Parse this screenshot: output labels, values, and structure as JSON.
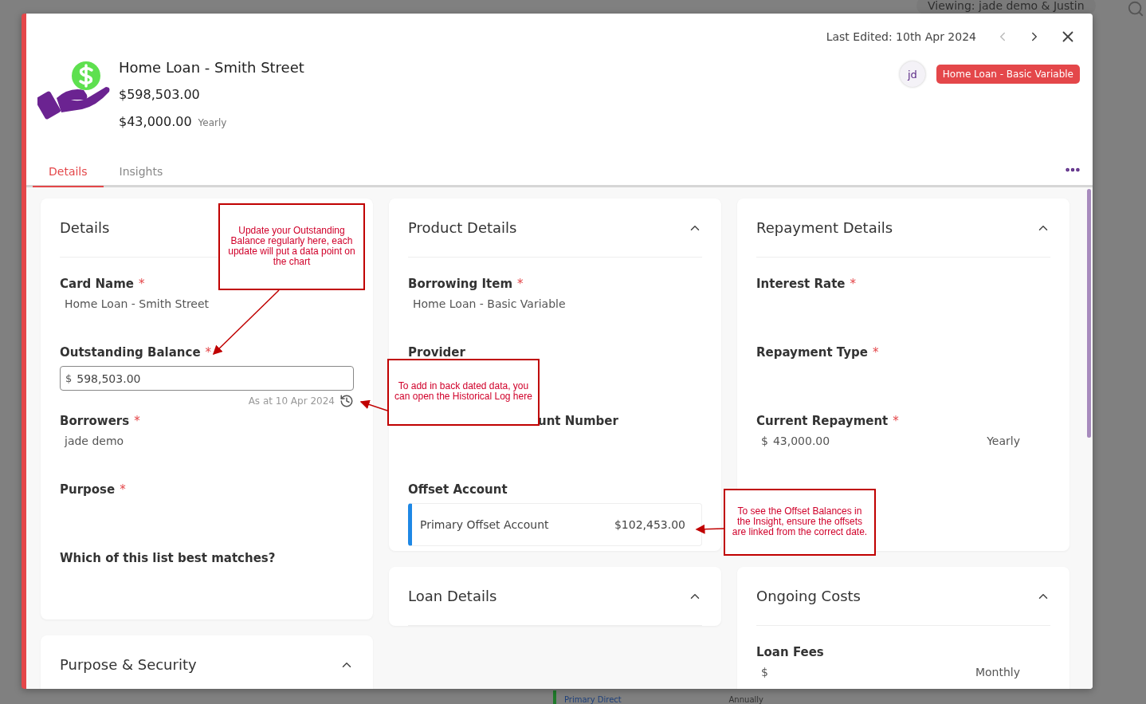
{
  "background": {
    "viewing": "Viewing: jade demo & Justin",
    "bottom_texts": [
      {
        "text": "Primary Direct",
        "kind": "link"
      },
      {
        "text": "Annually",
        "kind": "plain"
      }
    ]
  },
  "modal": {
    "last_edited": "Last Edited: 10th Apr 2024",
    "title": "Home Loan - Smith Street",
    "balance": "$598,503.00",
    "repayment": "$43,000.00",
    "repayment_frequency": "Yearly",
    "avatar": "jd",
    "tag": "Home Loan - Basic Variable",
    "tabs": [
      {
        "label": "Details",
        "selected": true
      },
      {
        "label": "Insights",
        "selected": false
      }
    ],
    "columns": [
      [
        {
          "title": "Details",
          "fields": [
            {
              "kind": "text",
              "label": "Card Name",
              "required_mark": "*",
              "value": "Home Loan - Smith Street"
            },
            {
              "kind": "input",
              "label": "Outstanding Balance",
              "required_mark": "*",
              "prefix": "$",
              "value": "598,503.00",
              "note": "As at 10 Apr 2024"
            },
            {
              "kind": "text",
              "label": "Borrowers",
              "required_mark": "*",
              "value": "jade demo"
            },
            {
              "kind": "text",
              "label": "Purpose",
              "required_mark": "*"
            },
            {
              "kind": "text",
              "label": "Which of this list best matches?"
            }
          ]
        },
        {
          "title": "Purpose & Security",
          "expanded": true
        }
      ],
      [
        {
          "title": "Product Details",
          "expanded": true,
          "fields": [
            {
              "kind": "text",
              "label": "Borrowing Item",
              "required_mark": "*",
              "value": "Home Loan - Basic Variable"
            },
            {
              "kind": "text",
              "label": "Provider"
            },
            {
              "kind": "covered",
              "label": "unt Number"
            },
            {
              "kind": "offset",
              "label": "Offset Account",
              "account": "Primary Offset Account",
              "amount": "$102,453.00"
            }
          ]
        },
        {
          "title": "Loan Details",
          "expanded": true
        }
      ],
      [
        {
          "title": "Repayment Details",
          "expanded": true,
          "fields": [
            {
              "kind": "text",
              "label": "Interest Rate",
              "required_mark": "*"
            },
            {
              "kind": "text",
              "label": "Repayment Type",
              "required_mark": "*"
            },
            {
              "kind": "amount",
              "label": "Current Repayment",
              "required_mark": "*",
              "prefix": "$",
              "value": "43,000.00",
              "frequency": "Yearly"
            },
            {
              "kind": "covered"
            }
          ]
        },
        {
          "title": "Ongoing Costs",
          "expanded": true,
          "fields": [
            {
              "kind": "amount",
              "label": "Loan Fees",
              "prefix": "$",
              "frequency": "Monthly"
            }
          ]
        }
      ]
    ]
  },
  "callouts": [
    "Update your Outstanding Balance regularly here, each update will put a data point on the chart",
    "To add in back dated data, you can open the Historical Log here",
    "To see the Offset Balances in the Insight, ensure the offsets are linked from the correct date."
  ]
}
